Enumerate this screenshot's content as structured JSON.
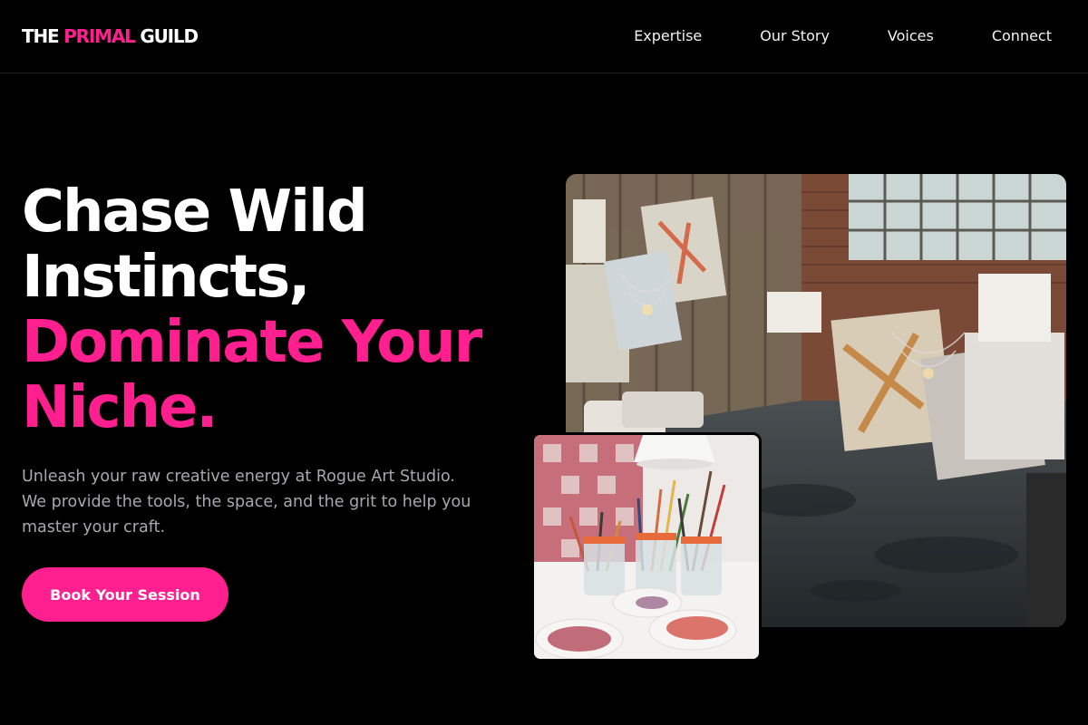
{
  "brand": {
    "part1": "THE ",
    "part2": "PRIMAL",
    "part3": " GUILD",
    "accent_color": "#ff1f8e"
  },
  "nav": {
    "items": [
      {
        "label": "Expertise"
      },
      {
        "label": "Our Story"
      },
      {
        "label": "Voices"
      },
      {
        "label": "Connect"
      }
    ]
  },
  "hero": {
    "line1": "Chase Wild",
    "line2": "Instincts,",
    "line3": "Dominate Your",
    "line4": "Niche.",
    "subtext": "Unleash your raw creative energy at Rogue Art Studio. We provide the tools, the space, and the grit to help you master your craft.",
    "cta_label": "Book Your Session"
  },
  "images": {
    "main": "art-studio-photo",
    "small": "paint-brushes-jars-photo"
  },
  "colors": {
    "background": "#000000",
    "text": "#ffffff",
    "muted": "#a8a8ad"
  }
}
